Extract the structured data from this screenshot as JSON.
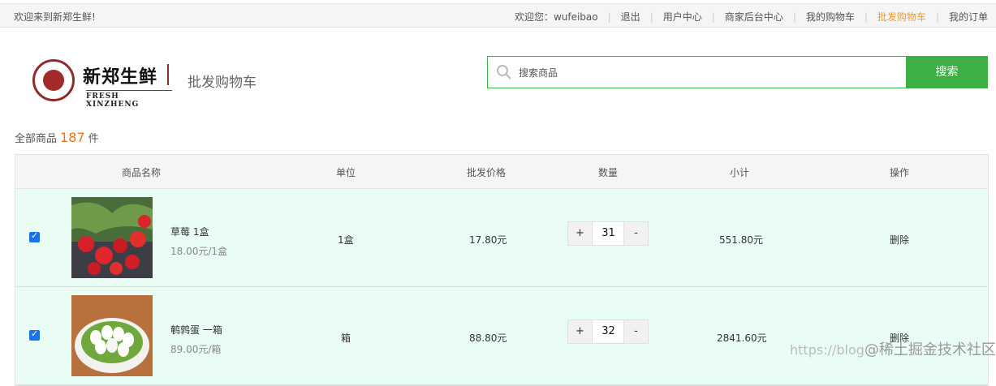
{
  "topbar": {
    "welcome": "欢迎来到新郑生鲜!",
    "greeting": "欢迎您：wufeibao",
    "nav": [
      "退出",
      "用户中心",
      "商家后台中心",
      "我的购物车",
      "批发购物车",
      "我的订单"
    ],
    "active_index": 4,
    "active_color": "#f59a23"
  },
  "logo": {
    "brand": "新郑生鲜",
    "sub": "FRESH XINZHENG",
    "brand_color": "#8e2b2b"
  },
  "page_title": "批发购物车",
  "search": {
    "placeholder": "搜索商品",
    "value": "",
    "button": "搜索",
    "accent": "#3cb043",
    "icon": "search-icon"
  },
  "summary": {
    "label": "全部商品",
    "count": "187",
    "unit": "件"
  },
  "table": {
    "headers": [
      "商品名称",
      "单位",
      "批发价格",
      "数量",
      "小计",
      "操作"
    ],
    "rows": [
      {
        "checked": true,
        "name": "草莓 1盒",
        "unit_price": "18.00元/1盒",
        "unit": "1盒",
        "price": "17.80元",
        "qty": "31",
        "plus": "+",
        "minus": "-",
        "subtotal": "551.80元",
        "action": "删除"
      },
      {
        "checked": true,
        "name": "鹌鹑蛋 一箱",
        "unit_price": "89.00元/箱",
        "unit": "箱",
        "price": "88.80元",
        "qty": "32",
        "plus": "+",
        "minus": "-",
        "subtotal": "2841.60元",
        "action": "删除"
      }
    ],
    "row_bg": "#e9fdf5"
  },
  "watermark": {
    "text": "https://blog",
    "brand": "@稀土掘金技术社区"
  }
}
